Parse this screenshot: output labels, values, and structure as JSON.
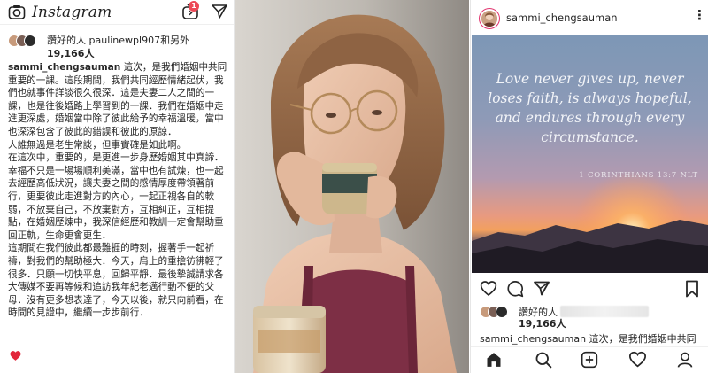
{
  "left_panel": {
    "app_logo": "Instagram",
    "tv_badge": "1",
    "liked_by_line": "讚好的人 paulinewpl907和另外",
    "likes_count": "19,166人",
    "caption_user": "sammi_chengsauman",
    "caption_text": " 這次，是我們婚姻中共同重要的一課。這段期間，我們共同經歷情緒起伏，我們也就事件詳談很久很深．這是夫妻二人之間的一課，也是往後婚路上學習到的一課．我們在婚姻中走進更深處，婚姻當中除了彼此給予的幸福溫暖，當中也深深包含了彼此的錯誤和彼此的原諒．\n人誰無過是老生常談，但事實確是如此啊。\n在這次中，重要的，是更進一步身歷婚姻其中真諦．幸福不只是一場場順利美滿，當中也有試煉，也一起去經歷高低狀況，讓夫妻之間的感情厚度帶領著前行，更要彼此走進對方的內心，一起正視各自的軟弱，不放棄自己，不放棄對方，互相糾正，互相提點，在婚姻歷煉中，我深信經歷和教訓一定會幫助重回正軌，生命更會更生．\n這期間在我們彼此都最難捱的時刻，握著手一起祈禱，對我們的幫助極大．今天，肩上的重擔彷彿輕了很多．只願一切快平息，回歸平靜．最後摯誠請求各大傳媒不要再等候和追訪我年紀老邁行動不便的父母．沒有更多想表達了，今天以後，就只向前看，在時間的見證中，繼續一步步前行．"
  },
  "right_panel": {
    "username": "sammi_chengsauman",
    "quote_text": "Love never gives up, never loses faith, is always hopeful, and endures through every circumstance.",
    "quote_reference": "1 CORINTHIANS 13:7 NLT",
    "liked_by_prefix": "讚好的人",
    "likes_count": "19,166人",
    "caption_user": "sammi_chengsauman",
    "caption_preview": " 這次，是我們婚姻中共同"
  },
  "icons": {
    "camera": "camera-icon",
    "igtv": "igtv-icon",
    "direct": "direct-message-icon",
    "heart_emoji": "red-heart-icon",
    "more": "more-options-icon",
    "like": "heart-outline-icon",
    "comment": "comment-icon",
    "share": "share-icon",
    "save": "bookmark-icon",
    "home": "home-icon",
    "search": "search-icon",
    "add": "new-post-icon",
    "activity": "activity-heart-icon",
    "profile": "profile-icon"
  },
  "colors": {
    "badge": "#ed4956",
    "heart": "#e2263b",
    "text": "#262626"
  }
}
